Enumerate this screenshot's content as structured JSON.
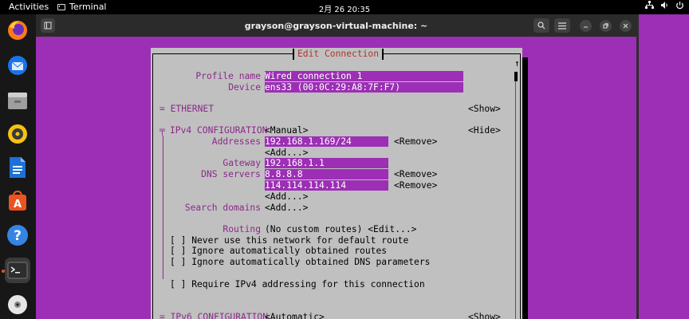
{
  "topbar": {
    "activities": "Activities",
    "app_name": "Terminal",
    "clock": "2月 26  20:35"
  },
  "window": {
    "title": "grayson@grayson-virtual-machine: ~"
  },
  "dialog": {
    "title": "Edit Connection",
    "profile_name_label": "Profile name",
    "profile_name_value": "Wired connection 1",
    "device_label": "Device",
    "device_value": "ens33 (00:0C:29:A8:7F:F7)",
    "ethernet_label": "= ETHERNET",
    "ethernet_toggle": "<Show>",
    "ipv4_label": "IPv4 CONFIGURATION",
    "ipv4_mode": "<Manual>",
    "ipv4_toggle": "<Hide>",
    "addresses_label": "Addresses",
    "address_value": "192.168.1.169/24",
    "remove": "<Remove>",
    "add": "<Add...>",
    "gateway_label": "Gateway",
    "gateway_value": "192.168.1.1",
    "dns_label": "DNS servers",
    "dns_values": [
      "8.8.8.8",
      "114.114.114.114"
    ],
    "search_domains_label": "Search domains",
    "routing_label": "Routing",
    "routing_value": "(No custom routes) <Edit...>",
    "checkboxes": [
      "[ ] Never use this network for default route",
      "[ ] Ignore automatically obtained routes",
      "[ ] Ignore automatically obtained DNS parameters",
      "[ ] Require IPv4 addressing for this connection"
    ],
    "ipv6_label": "= IPv6 CONFIGURATION",
    "ipv6_mode": "<Automatic>",
    "ipv6_toggle": "<Show>",
    "scroll_arrow": "↑"
  },
  "colors": {
    "terminal_bg": "#9c2fb5",
    "dialog_bg": "#c0c0c0",
    "label_color": "#8a2a8a",
    "title_color": "#b03232"
  }
}
